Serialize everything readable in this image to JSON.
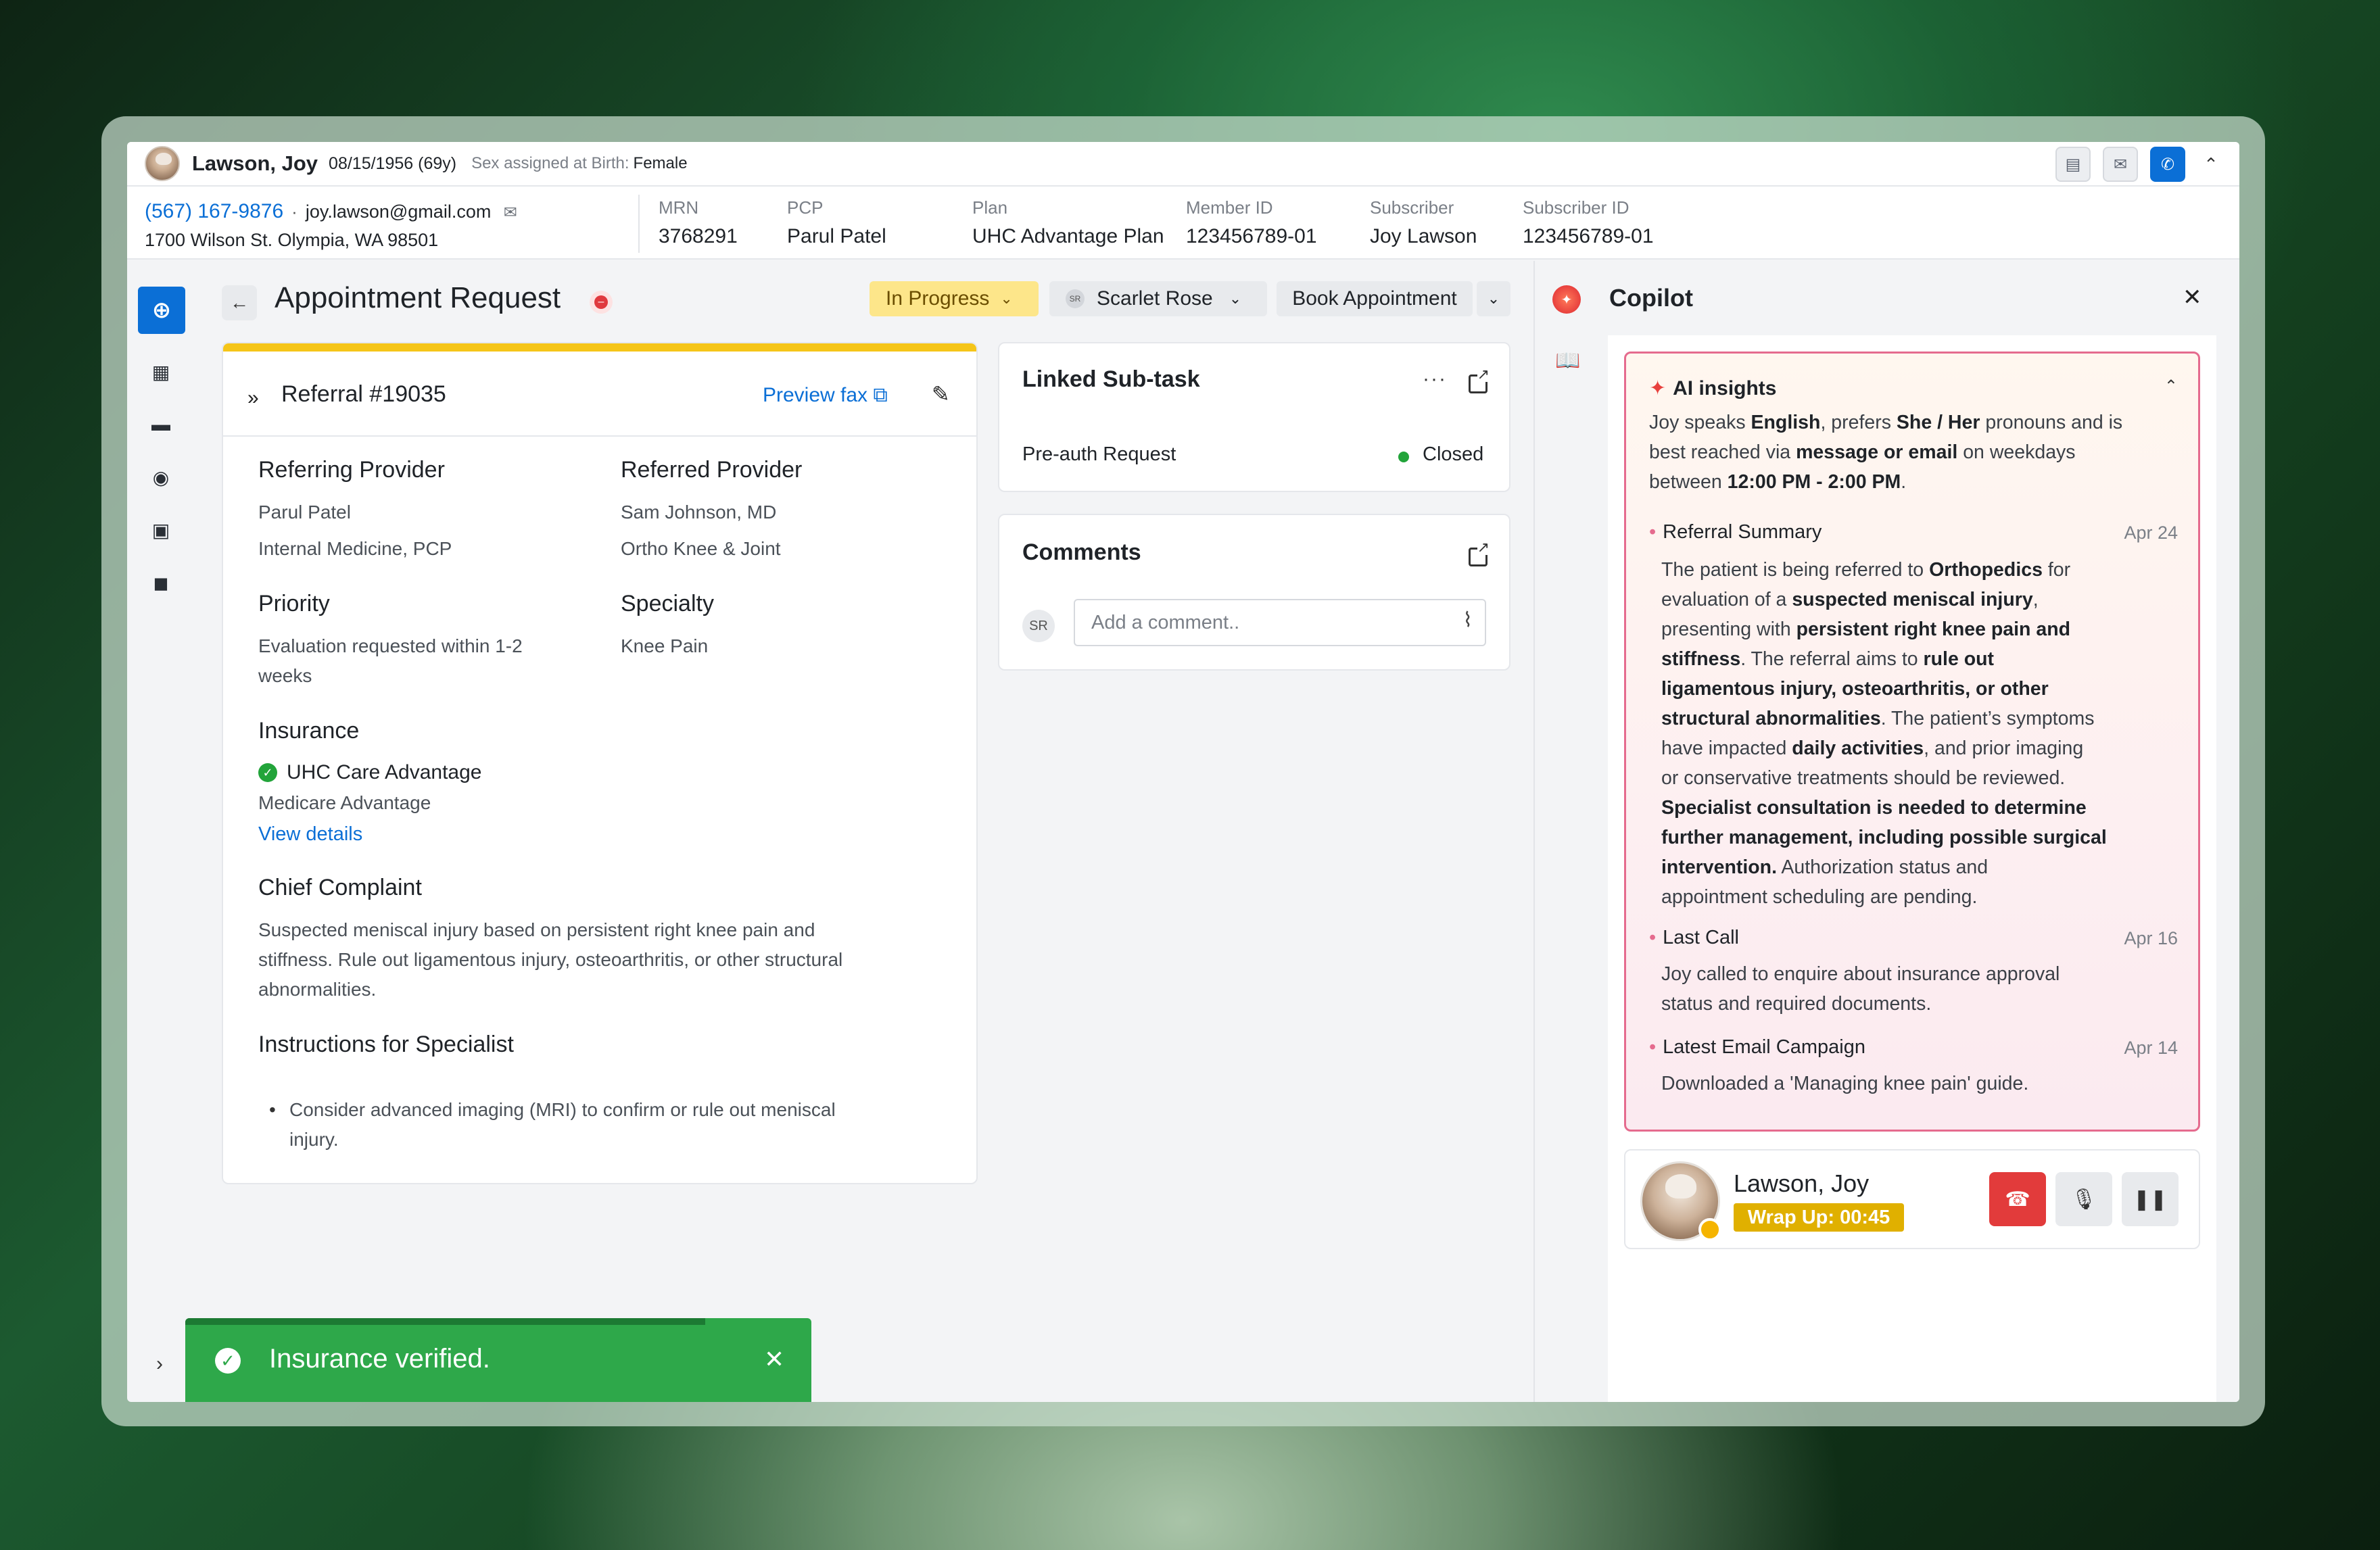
{
  "patient": {
    "name": "Lawson, Joy",
    "dob": "08/15/1956 (69y)",
    "sex_label": "Sex assigned at Birth:",
    "sex": "Female",
    "phone": "(567) 167-9876",
    "separator": "·",
    "email": "joy.lawson@gmail.com",
    "address": "1700 Wilson St. Olympia, WA 98501"
  },
  "meta": [
    {
      "label": "MRN",
      "value": "3768291"
    },
    {
      "label": "PCP",
      "value": "Parul Patel"
    },
    {
      "label": "Plan",
      "value": "UHC Advantage Plan"
    },
    {
      "label": "Member ID",
      "value": "123456789-01"
    },
    {
      "label": "Subscriber",
      "value": "Joy Lawson"
    },
    {
      "label": "Subscriber ID",
      "value": "123456789-01"
    }
  ],
  "toolbar": {
    "title": "Appointment Request",
    "status": "In Progress",
    "assignee_initials": "SR",
    "assignee": "Scarlet Rose",
    "book_label": "Book Appointment"
  },
  "referral": {
    "title": "Referral #19035",
    "preview_label": "Preview fax",
    "referring_h": "Referring Provider",
    "referring_name": "Parul Patel",
    "referring_dept": "Internal Medicine, PCP",
    "referred_h": "Referred Provider",
    "referred_name": "Sam Johnson, MD",
    "referred_dept": "Ortho Knee & Joint",
    "priority_h": "Priority",
    "priority_l1": "Evaluation requested within 1-2",
    "priority_l2": "weeks",
    "specialty_h": "Specialty",
    "specialty": "Knee Pain",
    "insurance_h": "Insurance",
    "insurance_name": "UHC Care Advantage",
    "insurance_type": "Medicare Advantage",
    "view_details": "View details",
    "complaint_h": "Chief Complaint",
    "complaint_l1": "Suspected meniscal injury based on persistent right knee pain and",
    "complaint_l2": "stiffness. Rule out ligamentous injury, osteoarthritis, or other structural",
    "complaint_l3": "abnormalities.",
    "instr_h": "Instructions for Specialist",
    "instr_l1": "Consider advanced imaging (MRI) to confirm or rule out meniscal",
    "instr_l2": "injury."
  },
  "subtask": {
    "title": "Linked Sub-task",
    "more": "···",
    "item": "Pre-auth Request",
    "status": "Closed"
  },
  "comments": {
    "title": "Comments",
    "avatar": "SR",
    "placeholder": "Add a comment.."
  },
  "copilot": {
    "title": "Copilot",
    "ai_title": "AI insights",
    "intro_l1_a": "Joy speaks ",
    "intro_l1_b": "English",
    "intro_l1_c": ", prefers ",
    "intro_l1_d": "She / Her",
    "intro_l1_e": " pronouns and is",
    "intro_l2_a": "best reached via ",
    "intro_l2_b": "message or email",
    "intro_l2_c": " on weekdays",
    "intro_l3_a": "between ",
    "intro_l3_b": "12:00 PM - 2:00 PM",
    "intro_l3_c": ".",
    "summary_title": "Referral Summary",
    "summary_date": "Apr 24",
    "last_call_title": "Last Call",
    "last_call_date": "Apr 16",
    "last_call_l1": "Joy called to enquire about insurance approval",
    "last_call_l2": "status and required documents.",
    "email_title": "Latest Email Campaign",
    "email_date": "Apr 14",
    "email_l1": "Downloaded a 'Managing knee pain' guide."
  },
  "summary_lines": [
    [
      [
        "n",
        "The patient is being referred to "
      ],
      [
        "b",
        "Orthopedics"
      ],
      [
        "n",
        " for"
      ]
    ],
    [
      [
        "n",
        "evaluation of a "
      ],
      [
        "b",
        "suspected meniscal injury"
      ],
      [
        "n",
        ","
      ]
    ],
    [
      [
        "n",
        "presenting with "
      ],
      [
        "b",
        "persistent right knee pain and"
      ]
    ],
    [
      [
        "b",
        "stiffness"
      ],
      [
        "n",
        ". The referral aims to "
      ],
      [
        "b",
        "rule out"
      ]
    ],
    [
      [
        "b",
        "ligamentous injury, osteoarthritis, or other"
      ]
    ],
    [
      [
        "b",
        "structural abnormalities"
      ],
      [
        "n",
        ". The patient’s symptoms"
      ]
    ],
    [
      [
        "n",
        "have impacted "
      ],
      [
        "b",
        "daily activities"
      ],
      [
        "n",
        ", and prior imaging"
      ]
    ],
    [
      [
        "n",
        "or conservative treatments should be reviewed."
      ]
    ],
    [
      [
        "b",
        "Specialist consultation is needed to determine"
      ]
    ],
    [
      [
        "b",
        "further management, including possible surgical"
      ]
    ],
    [
      [
        "b",
        "intervention."
      ],
      [
        "n",
        " Authorization status and"
      ]
    ],
    [
      [
        "n",
        "appointment scheduling are pending."
      ]
    ]
  ],
  "call": {
    "name": "Lawson, Joy",
    "wrap_up": "Wrap Up: 00:45"
  },
  "toast": {
    "message": "Insurance verified.",
    "progress": 0.83
  },
  "colors": {
    "primary": "#0b6fd6",
    "status_bg": "#fde68a",
    "success": "#2ea84a",
    "danger": "#e23b3b",
    "ai_border": "#e56b8e"
  }
}
